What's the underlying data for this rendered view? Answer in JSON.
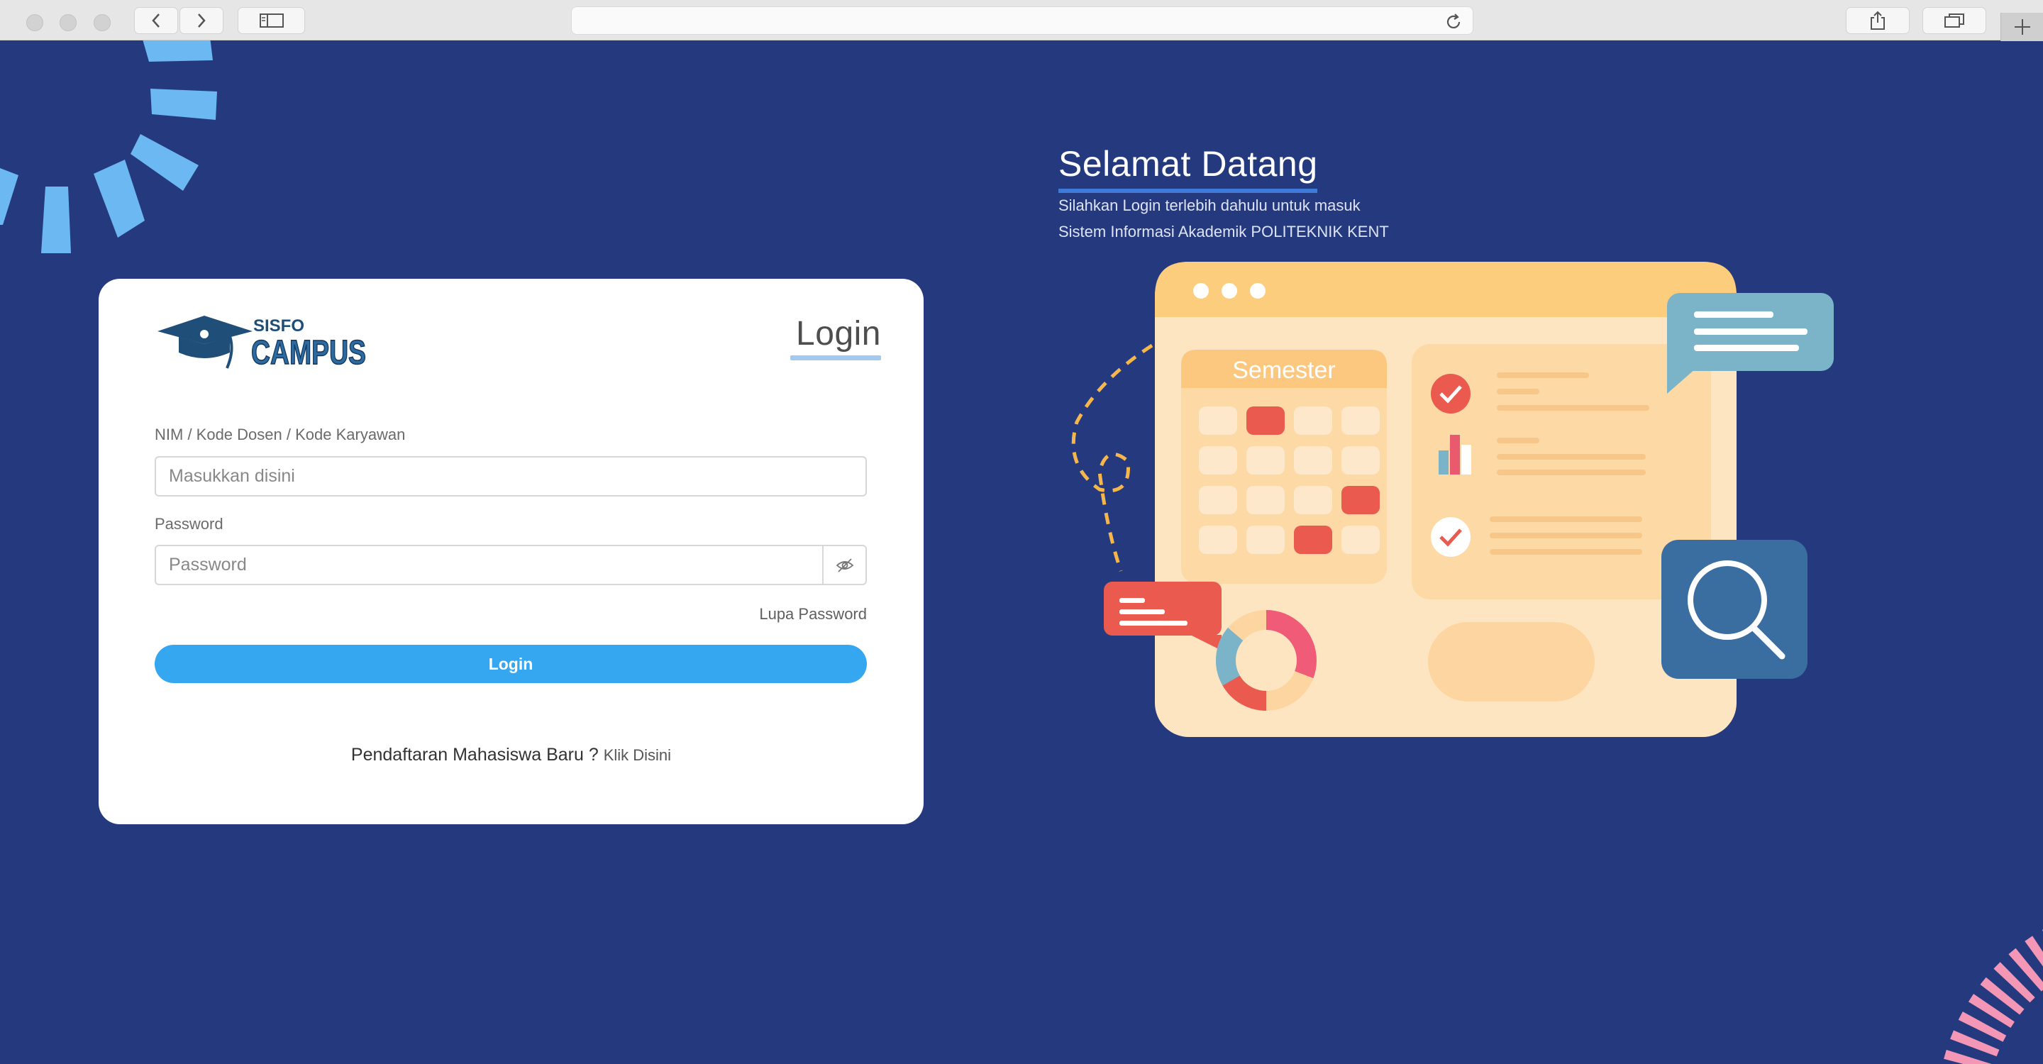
{
  "browser": {
    "address": ""
  },
  "colors": {
    "background": "#253a7e",
    "card": "#ffffff",
    "accent_button": "#35a7f1",
    "title_underline": "#a4c9f0",
    "welcome_underline": "#3f7ad8"
  },
  "logo": {
    "top": "SISFO",
    "bottom": "CAMPUS"
  },
  "login_form": {
    "title": "Login",
    "nim_label": "NIM / Kode Dosen / Kode Karyawan",
    "nim_placeholder": "Masukkan disini",
    "password_label": "Password",
    "password_placeholder": "Password",
    "forgot_password": "Lupa Password",
    "login_button": "Login",
    "register_text": "Pendaftaran Mahasiswa Baru ?",
    "register_link": "Klik Disini"
  },
  "welcome": {
    "title": "Selamat Datang",
    "line1": "Silahkan Login terlebih dahulu untuk masuk",
    "line2": "Sistem Informasi Akademik POLITEKNIK KENT"
  },
  "illustration": {
    "calendar_title": "Semester"
  },
  "icons": [
    "back-icon",
    "forward-icon",
    "sidebar-icon",
    "reload-icon",
    "share-icon",
    "tabs-icon",
    "plus-icon",
    "eye-slash-icon",
    "search-icon",
    "check-icon",
    "bar-chart-icon",
    "donut-chart-icon",
    "chat-bubble-icon"
  ]
}
